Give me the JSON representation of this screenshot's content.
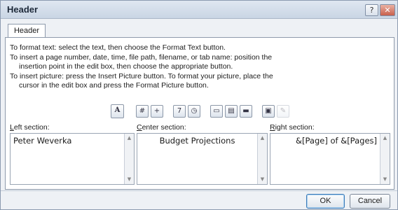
{
  "window": {
    "title": "Header",
    "help_label": "?",
    "close_label": "✕"
  },
  "tab": {
    "label": "Header"
  },
  "instructions": {
    "line1": "To format text:  select the text, then choose the Format Text button.",
    "line2": "To insert a page number, date, time, file path, filename, or tab name:  position the",
    "line3": "insertion point in the edit box, then choose the appropriate button.",
    "line4": "To insert picture: press the Insert Picture button.  To format your picture, place the",
    "line5": "cursor in the edit box and press the Format Picture button."
  },
  "toolbar": {
    "format_text_glyph": "A",
    "page_number_glyph": "#",
    "total_pages_glyph": "+",
    "date_glyph": "7",
    "time_glyph": "◷",
    "file_path_glyph": "▭",
    "filename_glyph": "▤",
    "sheet_name_glyph": "▬",
    "insert_picture_glyph": "▣",
    "format_picture_glyph": "✎"
  },
  "sections": {
    "left": {
      "label_key": "L",
      "label_rest": "eft section:",
      "value": "Peter Weverka"
    },
    "center": {
      "label_key": "C",
      "label_rest": "enter section:",
      "value": "Budget Projections"
    },
    "right": {
      "label_key": "R",
      "label_rest": "ight section:",
      "value": "&[Page] of &[Pages]"
    }
  },
  "scroll": {
    "up": "▲",
    "down": "▼"
  },
  "buttons": {
    "ok": "OK",
    "cancel": "Cancel"
  }
}
